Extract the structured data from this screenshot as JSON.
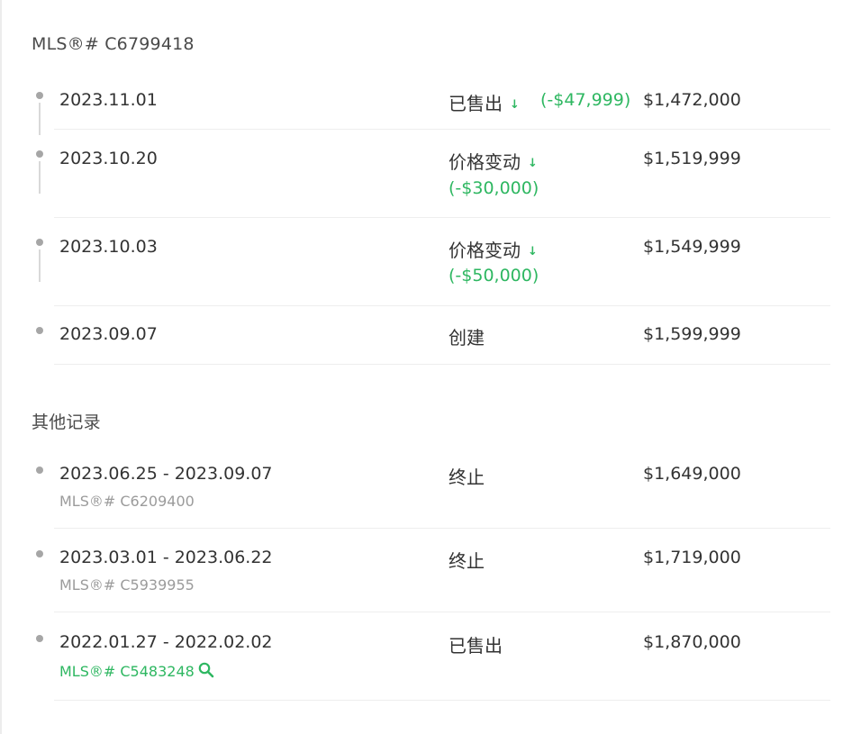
{
  "current_listing": {
    "mls_label": "MLS®# C6799418",
    "history": [
      {
        "date": "2023.11.01",
        "event": "已售出",
        "change": "(-$47,999)",
        "price": "$1,472,000"
      },
      {
        "date": "2023.10.20",
        "event": "价格变动",
        "change": "(-$30,000)",
        "price": "$1,519,999"
      },
      {
        "date": "2023.10.03",
        "event": "价格变动",
        "change": "(-$50,000)",
        "price": "$1,549,999"
      },
      {
        "date": "2023.09.07",
        "event": "创建",
        "price": "$1,599,999"
      }
    ]
  },
  "other_records": {
    "title": "其他记录",
    "items": [
      {
        "date_range": "2023.06.25 - 2023.09.07",
        "mls": "MLS®# C6209400",
        "event": "终止",
        "price": "$1,649,000"
      },
      {
        "date_range": "2023.03.01 - 2023.06.22",
        "mls": "MLS®# C5939955",
        "event": "终止",
        "price": "$1,719,000"
      },
      {
        "date_range": "2022.01.27 - 2022.02.02",
        "mls": "MLS®# C5483248",
        "event": "已售出",
        "price": "$1,870,000"
      }
    ]
  },
  "icons": {
    "down_arrow": "arrow-down-icon",
    "search": "search-icon"
  },
  "colors": {
    "accent_green": "#2eb761",
    "muted_gray": "#9b9b9b",
    "timeline_dot": "#a6a6a6"
  }
}
